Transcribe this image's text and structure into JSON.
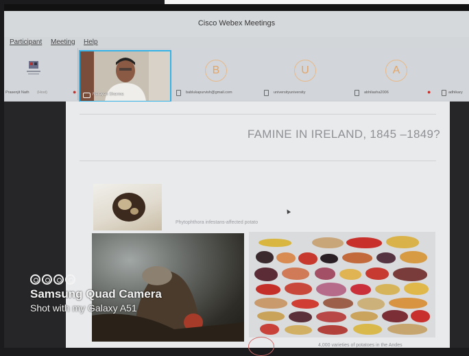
{
  "app": {
    "title": "Cisco Webex Meetings"
  },
  "menu": {
    "participant": "Participant",
    "meeting": "Meeting",
    "help": "Help"
  },
  "participants": [
    {
      "name": "Prasenjit Nath",
      "role": "(Host)"
    },
    {
      "name": "Narayan Sharma",
      "initial": ""
    },
    {
      "name": "bablukapurvish@gmail.com",
      "initial": "B"
    },
    {
      "name": "universityuniversity",
      "initial": "U"
    },
    {
      "name": "abhilasha2006",
      "initial": "A"
    },
    {
      "name": "adhikary"
    }
  ],
  "slide": {
    "title": "FAMINE IN IRELAND, 1845 –1849?",
    "caption_potato": "Phytophthora infestans-affected potato",
    "caption_varieties": "4,000 varieties of potatoes in the Andes"
  },
  "watermark": {
    "line1": "Samsung Quad Camera",
    "line2": "Shot with my Galaxy A51"
  },
  "colors": {
    "video_border": "#36b3e6",
    "avatar_accent": "#e2a467",
    "muted_mic": "#c8312b"
  }
}
